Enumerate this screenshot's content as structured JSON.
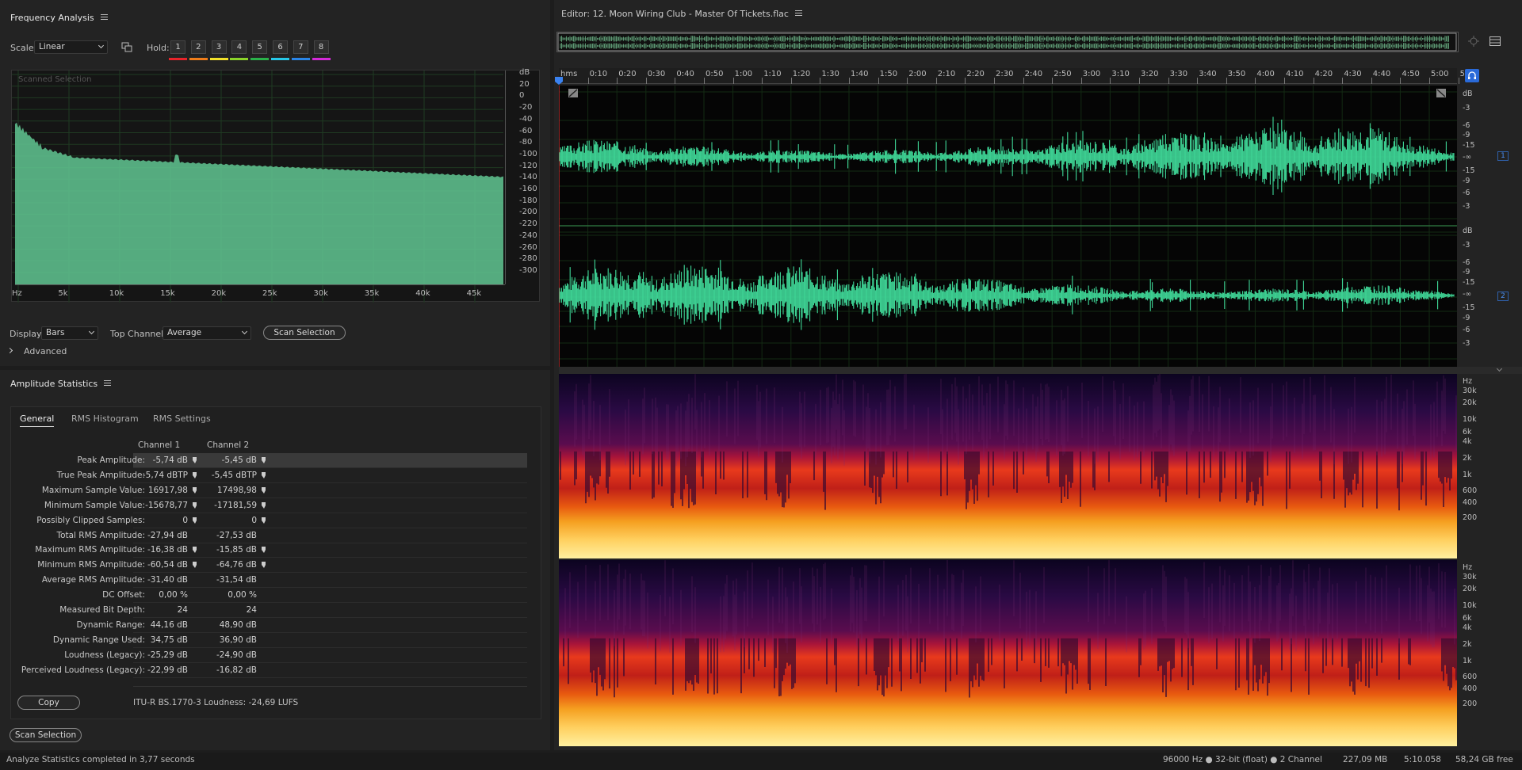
{
  "freq_panel": {
    "title": "Frequency Analysis",
    "scale_label": "Scale:",
    "scale_value": "Linear",
    "hold_label": "Hold:",
    "hold_buttons": [
      "1",
      "2",
      "3",
      "4",
      "5",
      "6",
      "7",
      "8"
    ],
    "hold_colors": [
      "#e8242a",
      "#f07d1a",
      "#f2e12a",
      "#8cd42a",
      "#2ab24a",
      "#27c8e8",
      "#2a86e8",
      "#d42ad8"
    ],
    "overlay": "Scanned Selection",
    "db_axis": [
      "dB",
      "20",
      "0",
      "-20",
      "-40",
      "-60",
      "-80",
      "-100",
      "-120",
      "-140",
      "-160",
      "-180",
      "-200",
      "-220",
      "-240",
      "-260",
      "-280",
      "-300"
    ],
    "hz_axis": [
      "Hz",
      "5k",
      "10k",
      "15k",
      "20k",
      "25k",
      "30k",
      "35k",
      "40k",
      "45k"
    ],
    "display_label": "Display:",
    "display_value": "Bars",
    "top_channel_label": "Top Channel:",
    "top_channel_value": "Average",
    "scan_button": "Scan Selection",
    "advanced": "Advanced",
    "spectrum_color": "#5fc08e"
  },
  "amp_panel": {
    "title": "Amplitude Statistics",
    "tabs": [
      "General",
      "RMS Histogram",
      "RMS Settings"
    ],
    "col1": "Channel 1",
    "col2": "Channel 2",
    "rows": [
      {
        "label": "Peak Amplitude:",
        "c1": "-5,74 dB",
        "c2": "-5,45 dB",
        "marker": true
      },
      {
        "label": "True Peak Amplitude:",
        "c1": "-5,74 dBTP",
        "c2": "-5,45 dBTP",
        "marker": true
      },
      {
        "label": "Maximum Sample Value:",
        "c1": "16917,98",
        "c2": "17498,98",
        "marker": true
      },
      {
        "label": "Minimum Sample Value:",
        "c1": "-15678,77",
        "c2": "-17181,59",
        "marker": true
      },
      {
        "label": "Possibly Clipped Samples:",
        "c1": "0",
        "c2": "0",
        "marker": true
      },
      {
        "label": "Total RMS Amplitude:",
        "c1": "-27,94 dB",
        "c2": "-27,53 dB",
        "marker": false
      },
      {
        "label": "Maximum RMS Amplitude:",
        "c1": "-16,38 dB",
        "c2": "-15,85 dB",
        "marker": true
      },
      {
        "label": "Minimum RMS Amplitude:",
        "c1": "-60,54 dB",
        "c2": "-64,76 dB",
        "marker": true
      },
      {
        "label": "Average RMS Amplitude:",
        "c1": "-31,40 dB",
        "c2": "-31,54 dB",
        "marker": false
      },
      {
        "label": "DC Offset:",
        "c1": "0,00 %",
        "c2": "0,00 %",
        "marker": false
      },
      {
        "label": "Measured Bit Depth:",
        "c1": "24",
        "c2": "24",
        "marker": false
      },
      {
        "label": "Dynamic Range:",
        "c1": "44,16 dB",
        "c2": "48,90 dB",
        "marker": false
      },
      {
        "label": "Dynamic Range Used:",
        "c1": "34,75 dB",
        "c2": "36,90 dB",
        "marker": false
      },
      {
        "label": "Loudness (Legacy):",
        "c1": "-25,29 dB",
        "c2": "-24,90 dB",
        "marker": false
      },
      {
        "label": "Perceived Loudness (Legacy):",
        "c1": "-22,99 dB",
        "c2": "-16,82 dB",
        "marker": false
      }
    ],
    "copy_button": "Copy",
    "loudness": "ITU-R BS.1770-3 Loudness: -24,69 LUFS",
    "scan_button": "Scan Selection"
  },
  "editor": {
    "title": "Editor: 12. Moon Wiring Club - Master Of Tickets.flac",
    "timeline": [
      "hms",
      "0:10",
      "0:20",
      "0:30",
      "0:40",
      "0:50",
      "1:00",
      "1:10",
      "1:20",
      "1:30",
      "1:40",
      "1:50",
      "2:00",
      "2:10",
      "2:20",
      "2:30",
      "2:40",
      "2:50",
      "3:00",
      "3:10",
      "3:20",
      "3:30",
      "3:40",
      "3:50",
      "4:00",
      "4:10",
      "4:20",
      "4:30",
      "4:40",
      "4:50",
      "5:00",
      "5:"
    ],
    "wave_db": [
      "dB",
      "-3",
      "-6",
      "-9",
      "-15",
      "-∞",
      "-15",
      "-9",
      "-6",
      "-3"
    ],
    "channel1": "1",
    "channel2": "2",
    "spec_hz": [
      "Hz",
      "30k",
      "20k",
      "10k",
      "6k",
      "4k",
      "2k",
      "1k",
      "600",
      "400",
      "200"
    ],
    "wave_color": "#3fd898"
  },
  "statusbar": {
    "message": "Analyze Statistics completed in 3,77 seconds",
    "format": "96000 Hz ● 32-bit (float) ● 2 Channel",
    "size": "227,09 MB",
    "duration": "5:10.058",
    "free": "58,24 GB free"
  }
}
